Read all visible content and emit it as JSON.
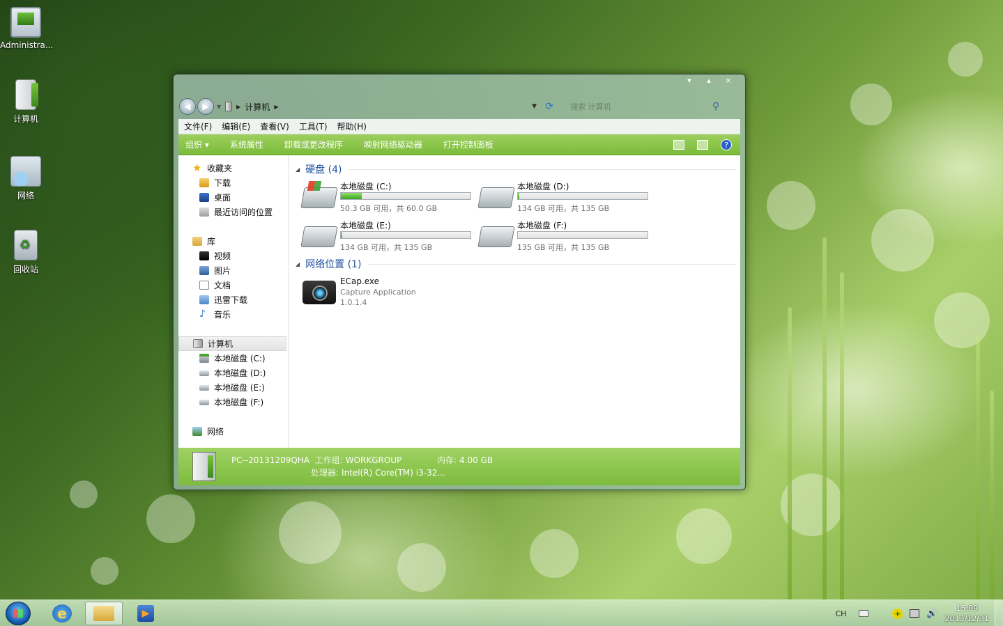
{
  "desktop": {
    "icons": [
      {
        "label": "Administra..."
      },
      {
        "label": "计算机"
      },
      {
        "label": "网络"
      },
      {
        "label": "回收站"
      }
    ]
  },
  "window": {
    "controls": {
      "minimize": "▾",
      "maximize": "▴",
      "close": "×"
    },
    "nav": {
      "back_glyph": "◀",
      "forward_glyph": "▶",
      "breadcrumb": "计算机",
      "search_placeholder": "搜索 计算机"
    },
    "menu": [
      "文件(F)",
      "编辑(E)",
      "查看(V)",
      "工具(T)",
      "帮助(H)"
    ],
    "toolbar": {
      "organize": "组织 ▾",
      "items": [
        "系统属性",
        "卸载或更改程序",
        "映射网络驱动器",
        "打开控制面板"
      ],
      "help": "?"
    },
    "sidebar": {
      "favorites": {
        "label": "收藏夹",
        "items": [
          "下载",
          "桌面",
          "最近访问的位置"
        ]
      },
      "libraries": {
        "label": "库",
        "items": [
          "视频",
          "图片",
          "文档",
          "迅雷下载",
          "音乐"
        ]
      },
      "computer": {
        "label": "计算机",
        "items": [
          "本地磁盘 (C:)",
          "本地磁盘 (D:)",
          "本地磁盘 (E:)",
          "本地磁盘 (F:)"
        ]
      },
      "network": {
        "label": "网络"
      }
    },
    "groups": {
      "hard_disks": {
        "title": "硬盘 (4)",
        "drives": [
          {
            "name": "本地磁盘 (C:)",
            "free_text": "50.3 GB 可用，共 60.0 GB",
            "used_fraction": 0.16
          },
          {
            "name": "本地磁盘 (D:)",
            "free_text": "134 GB 可用，共 135 GB",
            "used_fraction": 0.01
          },
          {
            "name": "本地磁盘 (E:)",
            "free_text": "134 GB 可用，共 135 GB",
            "used_fraction": 0.01
          },
          {
            "name": "本地磁盘 (F:)",
            "free_text": "135 GB 可用，共 135 GB",
            "used_fraction": 0.0
          }
        ]
      },
      "network_locations": {
        "title": "网络位置 (1)",
        "items": [
          {
            "name": "ECap.exe",
            "description": "Capture Application",
            "version": "1.0.1.4"
          }
        ]
      }
    },
    "details": {
      "pc_name": "PC--20131209QHA",
      "workgroup_label": "工作组:",
      "workgroup": "WORKGROUP",
      "memory_label": "内存:",
      "memory": "4.00 GB",
      "cpu_label": "处理器:",
      "cpu": "Intel(R) Core(TM) i3-32..."
    }
  },
  "taskbar": {
    "tray": {
      "lang": "CH",
      "volume_glyph": "🔊",
      "time": "15:09",
      "date": "2013/12/31"
    }
  },
  "colors": {
    "toolbar_green": "#8cc64c",
    "link_blue": "#1e4fa0",
    "bar_fill": "#39a81f"
  }
}
